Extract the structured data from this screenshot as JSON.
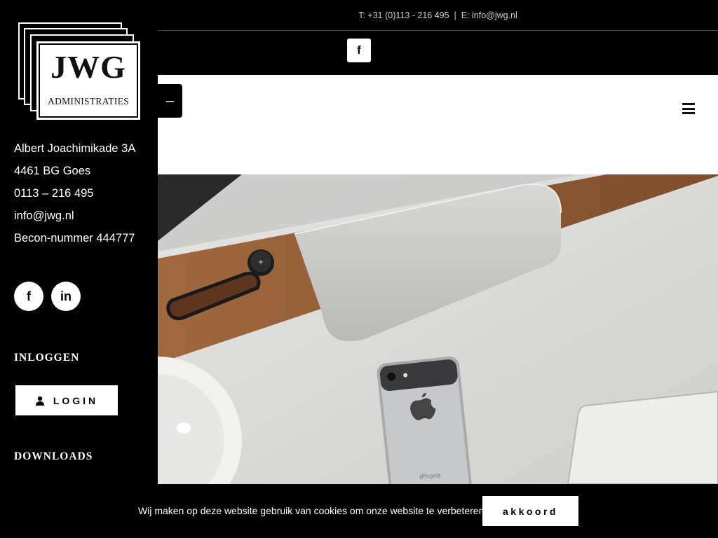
{
  "topbar": {
    "contact_line": "T: +31 (0)113 - 216 495  |  E: info@jwg.nl"
  },
  "logo": {
    "mark": "JWG",
    "subtitle": "ADMINISTRATIES"
  },
  "sidebar": {
    "contact_lines": [
      "Albert Joachimikade 3A",
      "4461 BG Goes",
      "0113 – 216 495",
      "info@jwg.nl",
      "Becon-nummer 444777"
    ],
    "social": [
      {
        "icon": "facebook-icon",
        "glyph": "f"
      },
      {
        "icon": "linkedin-icon",
        "glyph": "in"
      }
    ],
    "login_heading": "INLOGGEN",
    "login_button": "LOGIN",
    "downloads_heading": "DOWNLOADS"
  },
  "header": {
    "facebook_glyph": "f",
    "collapse_glyph": "–",
    "menu_icon": "hamburger-menu-icon"
  },
  "hero": {
    "alt": "desk with computer and phone"
  },
  "cookie": {
    "message": "Wij maken op deze website gebruik van cookies om onze website te verbeteren.",
    "accept_label": "akkoord"
  },
  "colors": {
    "background": "#000000",
    "header": "#ffffff",
    "text": "#ffffff"
  }
}
